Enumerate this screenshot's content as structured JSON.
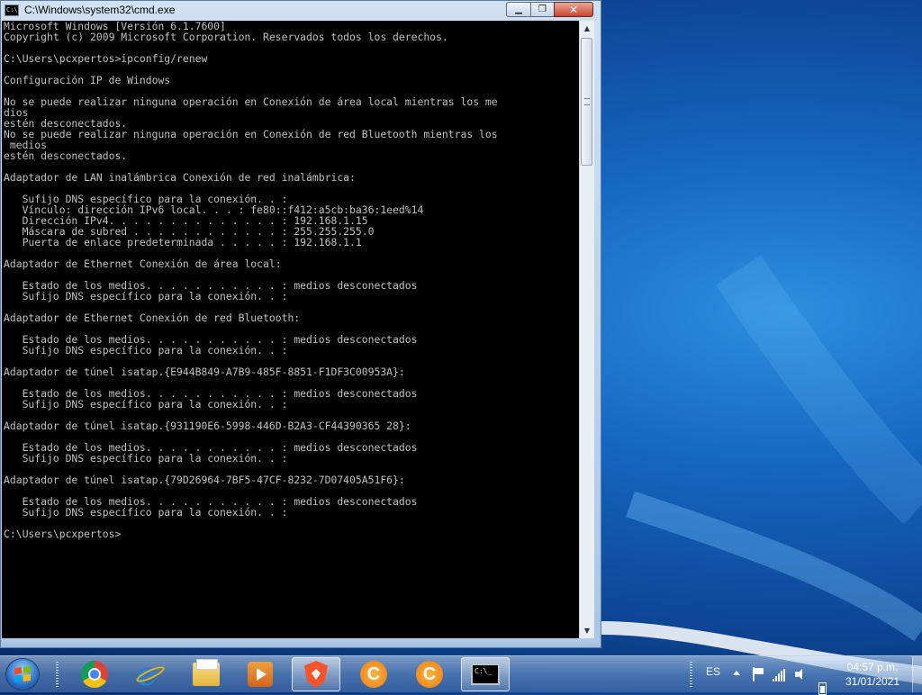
{
  "window": {
    "title": "C:\\Windows\\system32\\cmd.exe",
    "icon_label": "C:\\",
    "buttons": {
      "minimize": "▁",
      "maximize": "❐",
      "close": "✕"
    }
  },
  "console": {
    "text": "Microsoft Windows [Versión 6.1.7600]\nCopyright (c) 2009 Microsoft Corporation. Reservados todos los derechos.\n\nC:\\Users\\pcxpertos>ipconfig/renew\n\nConfiguración IP de Windows\n\nNo se puede realizar ninguna operación en Conexión de área local mientras los me\ndios\nestén desconectados.\nNo se puede realizar ninguna operación en Conexión de red Bluetooth mientras los\n medios\nestén desconectados.\n\nAdaptador de LAN inalámbrica Conexión de red inalámbrica:\n\n   Sufijo DNS específico para la conexión. . :\n   Vínculo: dirección IPv6 local. . . : fe80::f412:a5cb:ba36:1eed%14\n   Dirección IPv4. . . . . . . . . . . . . . : 192.168.1.15\n   Máscara de subred . . . . . . . . . . . . : 255.255.255.0\n   Puerta de enlace predeterminada . . . . . : 192.168.1.1\n\nAdaptador de Ethernet Conexión de área local:\n\n   Estado de los medios. . . . . . . . . . . : medios desconectados\n   Sufijo DNS específico para la conexión. . :\n\nAdaptador de Ethernet Conexión de red Bluetooth:\n\n   Estado de los medios. . . . . . . . . . . : medios desconectados\n   Sufijo DNS específico para la conexión. . :\n\nAdaptador de túnel isatap.{E944B849-A7B9-485F-8851-F1DF3C00953A}:\n\n   Estado de los medios. . . . . . . . . . . : medios desconectados\n   Sufijo DNS específico para la conexión. . :\n\nAdaptador de túnel isatap.{931190E6-5998-446D-B2A3-CF44390365 28}:\n\n   Estado de los medios. . . . . . . . . . . : medios desconectados\n   Sufijo DNS específico para la conexión. . :\n\nAdaptador de túnel isatap.{79D26964-7BF5-47CF-8232-7D07405A51F6}:\n\n   Estado de los medios. . . . . . . . . . . : medios desconectados\n   Sufijo DNS específico para la conexión. . :\n\nC:\\Users\\pcxpertos>"
  },
  "taskbar": {
    "apps": [
      {
        "name": "chrome-icon",
        "active": false
      },
      {
        "name": "internet-explorer-icon",
        "active": false
      },
      {
        "name": "file-explorer-icon",
        "active": false
      },
      {
        "name": "media-player-icon",
        "active": false
      },
      {
        "name": "brave-icon",
        "active": false
      },
      {
        "name": "ccleaner-icon",
        "active": false,
        "glyph": "C"
      },
      {
        "name": "ccleaner-icon-2",
        "active": false,
        "glyph": "C"
      },
      {
        "name": "cmd-icon",
        "active": true,
        "glyph": "C:\\_"
      }
    ],
    "tray": {
      "language": "ES",
      "time": "04:57 p.m.",
      "date": "31/01/2021"
    }
  },
  "colors": {
    "console_bg": "#000000",
    "console_fg": "#c0c0c0",
    "desktop_blue": "#1565c0"
  }
}
